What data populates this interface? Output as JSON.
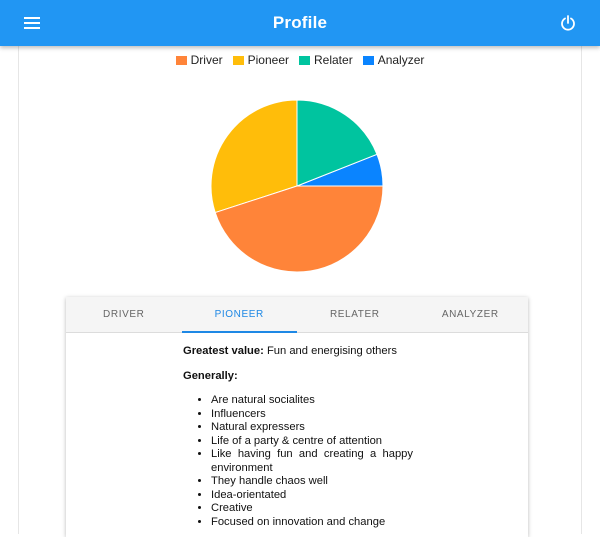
{
  "appbar": {
    "title": "Profile",
    "menu_icon": "hamburger-menu-icon",
    "power_icon": "power-icon",
    "background": "#2196f3"
  },
  "chart_data": {
    "type": "pie",
    "legend_position": "top",
    "categories": [
      "Driver",
      "Pioneer",
      "Relater",
      "Analyzer"
    ],
    "values": [
      45,
      30,
      19,
      6
    ],
    "colors": [
      "#ff8439",
      "#ffbd0a",
      "#00c49f",
      "#0a84ff"
    ]
  },
  "tabs": [
    "DRIVER",
    "PIONEER",
    "RELATER",
    "ANALYZER"
  ],
  "active_tab": "PIONEER",
  "content": {
    "greatest_value_label": "Greatest value:",
    "greatest_value_text": "Fun and energising others",
    "generally_label": "Generally:",
    "bullets": [
      "Are natural socialites",
      "Influencers",
      "Natural expressers",
      "Life of a party & centre of attention",
      "Like having fun and creating a happy environment",
      "They handle chaos well",
      "Idea-orientated",
      "Creative",
      "Focused on innovation and change"
    ]
  }
}
